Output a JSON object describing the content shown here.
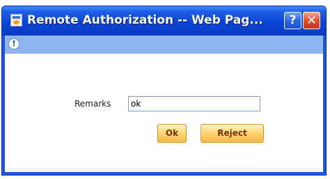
{
  "window": {
    "title": "Remote Authorization -- Web Pag...",
    "help_symbol": "?",
    "close_symbol": "✕",
    "info_symbol": "!"
  },
  "form": {
    "remarks_label": "Remarks",
    "remarks_value": "ok",
    "ok_label": "Ok",
    "reject_label": "Reject"
  },
  "icons": {
    "title": "webpage-dialog-icon",
    "info": "info-icon",
    "help": "help-icon",
    "close": "close-icon"
  },
  "colors": {
    "titlebar": "#0a45d3",
    "info_bar": "#8fb3ec",
    "button": "#fdd77a",
    "button_text": "#7a2e00",
    "close_button": "#e0512c"
  }
}
